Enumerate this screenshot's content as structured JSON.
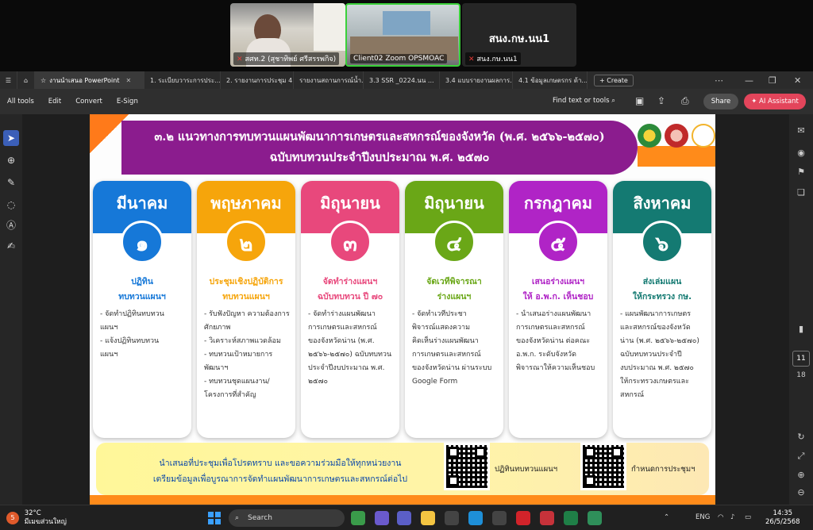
{
  "zoom": {
    "participants": [
      {
        "name": "สศท.2 (สุชาทิพย์ ศรีสรรพกิจ)"
      },
      {
        "name": "Client02 Zoom OPSMOAC"
      },
      {
        "name": "สนง.กษ.นน1"
      }
    ],
    "speaker_label": "สนง.กษ.นน1"
  },
  "tabs": {
    "items": [
      {
        "label": "งานนำเสนอ PowerPoint",
        "active": true
      },
      {
        "label": "1. ระเบียบวาระการประ..."
      },
      {
        "label": "2. รายงานการประชุม 4..."
      },
      {
        "label": "รายงานสถานการณ์น้ำ..."
      },
      {
        "label": "3.3 SSR _0224.นน ..."
      },
      {
        "label": "3.4 แบบรายงานผลการ..."
      },
      {
        "label": "4.1 ข้อมูลเกษตรกร ด้า..."
      }
    ],
    "create_label": "Create"
  },
  "toolbar": {
    "menus": [
      "All tools",
      "Edit",
      "Convert",
      "E-Sign"
    ],
    "find_label": "Find text or tools",
    "share_label": "Share",
    "ai_label": "AI Assistant"
  },
  "pager": {
    "current": "11",
    "total": "18"
  },
  "slide": {
    "title_line1": "๓.๒ แนวทางการทบทวนแผนพัฒนาการเกษตรและสหกรณ์ของจังหวัด (พ.ศ. ๒๕๖๖-๒๕๗๐)",
    "title_line2": "ฉบับทบทวนประจำปีงบประมาณ พ.ศ. ๒๕๗๐",
    "cards": [
      {
        "month": "มีนาคม",
        "num": "๑",
        "head": "ปฏิทิน\nทบทวนแผนฯ",
        "body": "- จัดทำปฏิทินทบทวน\n  แผนฯ\n- แจ้งปฏิทินทบทวน\n  แผนฯ"
      },
      {
        "month": "พฤษภาคม",
        "num": "๒",
        "head": "ประชุมเชิงปฏิบัติการ\nทบทวนแผนฯ",
        "body": "- รับฟังปัญหา ความต้องการ\n  ศักยภาพ\n- วิเคราะห์สภาพแวดล้อม\n- ทบทวนเป้าหมายการ\n  พัฒนาฯ\n- ทบทวนชุดแผนงาน/\n  โครงการที่สำคัญ"
      },
      {
        "month": "มิถุนายน",
        "num": "๓",
        "head": "จัดทำร่างแผนฯ\nฉบับทบทวน ปี ๗๐",
        "body": "- จัดทำร่างแผนพัฒนา\n  การเกษตรและสหกรณ์\n  ของจังหวัดน่าน (พ.ศ.\n  ๒๕๖๖-๒๕๗๐) ฉบับทบทวน\n  ประจำปีงบประมาณ พ.ศ.\n  ๒๕๗๐"
      },
      {
        "month": "มิถุนายน",
        "num": "๔",
        "head": "จัดเวทีพิจารณา\nร่างแผนฯ",
        "body": "- จัดทำเวทีประชา\n  พิจารณ์แสดงความ\n  คิดเห็นร่างแผนพัฒนา\n  การเกษตรและสหกรณ์\n  ของจังหวัดน่าน ผ่านระบบ\n  Google Form"
      },
      {
        "month": "กรกฎาคม",
        "num": "๕",
        "head": "เสนอร่างแผนฯ\nให้ อ.พ.ก. เห็นชอบ",
        "body": "- นำเสนอร่างแผนพัฒนา\n  การเกษตรและสหกรณ์\n  ของจังหวัดน่าน ต่อคณะ\n  อ.พ.ก. ระดับจังหวัด\n  พิจารณาให้ความเห็นชอบ"
      },
      {
        "month": "สิงหาคม",
        "num": "๖",
        "head": "ส่งเล่มแผน\nให้กระทรวง กษ.",
        "body": "- แผนพัฒนาการเกษตร\n  และสหกรณ์ของจังหวัด\n  น่าน (พ.ศ. ๒๕๖๖-๒๕๗๐)\n  ฉบับทบทวนประจำปี\n  งบประมาณ พ.ศ. ๒๕๗๐\n  ให้กระทรวงเกษตรและ\n  สหกรณ์"
      }
    ],
    "footer_line1": "นำเสนอที่ประชุมเพื่อโปรดทราบ และขอความร่วมมือให้ทุกหน่วยงาน",
    "footer_line2": "เตรียมข้อมูลเพื่อบูรณาการจัดทำแผนพัฒนาการเกษตรและสหกรณ์ต่อไป",
    "qr1_label": "ปฏิทินทบทวนแผนฯ",
    "qr2_label": "กำหนดการประชุมฯ"
  },
  "taskbar": {
    "temp": "32°C",
    "weather": "มีเมฆส่วนใหญ่",
    "badge": "5",
    "search_label": "Search",
    "lang": "ENG",
    "time": "14:35",
    "date": "26/5/2568"
  },
  "colors": {
    "card_colors": [
      "#1678d8",
      "#f6a50b",
      "#e8487c",
      "#6aa717",
      "#b024c6",
      "#147a72"
    ],
    "header_purple": "#8b1c8e",
    "accent_orange": "#ff8b1a"
  }
}
